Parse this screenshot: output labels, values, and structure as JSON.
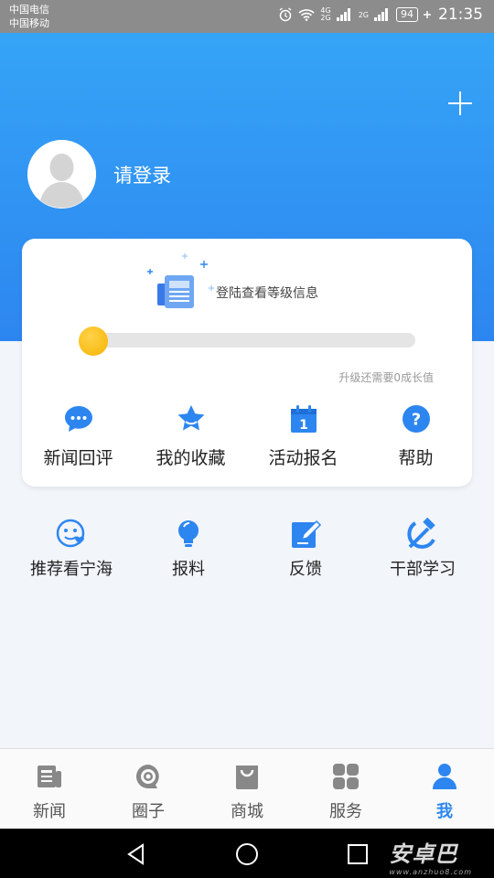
{
  "status_bar": {
    "carrier1": "中国电信",
    "carrier2": "中国移动",
    "net1": "4G",
    "net2": "2G",
    "net3": "2G",
    "battery": "94",
    "time": "21:35"
  },
  "header": {
    "login_text": "请登录",
    "gradient_top": "#35a4f6",
    "gradient_bottom": "#2d86f0"
  },
  "level_card": {
    "level_text": "登陆查看等级信息",
    "progress": 0,
    "upgrade_text": "升级还需要0成长值",
    "items": [
      {
        "label": "新闻回评",
        "icon": "comment-bubble-icon"
      },
      {
        "label": "我的收藏",
        "icon": "star-favorites-icon"
      },
      {
        "label": "活动报名",
        "icon": "calendar-icon"
      },
      {
        "label": "帮助",
        "icon": "help-question-icon"
      }
    ]
  },
  "services": [
    {
      "label": "推荐看宁海",
      "icon": "smiley-heart-icon"
    },
    {
      "label": "报料",
      "icon": "lightbulb-icon"
    },
    {
      "label": "反馈",
      "icon": "edit-pen-icon"
    },
    {
      "label": "干部学习",
      "icon": "hammer-sickle-icon"
    }
  ],
  "tabbar": {
    "tabs": [
      {
        "label": "新闻",
        "icon": "newspaper-icon"
      },
      {
        "label": "圈子",
        "icon": "circle-chat-icon"
      },
      {
        "label": "商城",
        "icon": "shopping-bag-icon"
      },
      {
        "label": "服务",
        "icon": "grid-services-icon"
      },
      {
        "label": "我",
        "icon": "person-icon"
      }
    ],
    "active_index": 4,
    "active_color": "#2d86f0"
  },
  "watermark": {
    "text": "安卓巴",
    "subtext": "www.anzhuo8.com"
  }
}
